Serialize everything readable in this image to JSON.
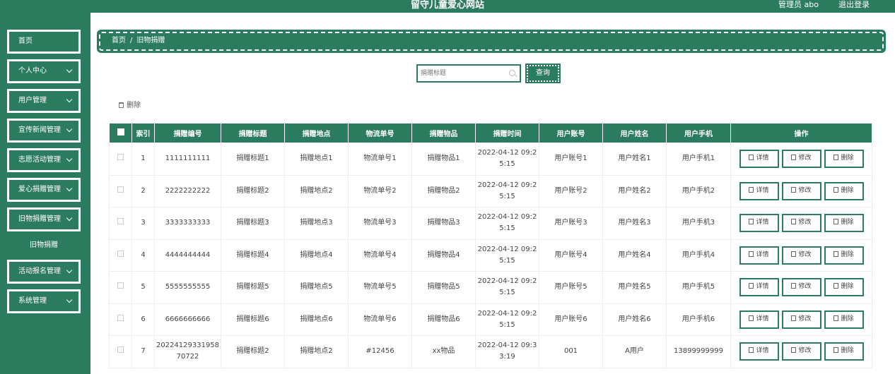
{
  "header": {
    "title": "留守儿童爱心网站",
    "user": "管理员 abo",
    "logout": "退出登录"
  },
  "sidebar": {
    "items": [
      {
        "label": "首页"
      },
      {
        "label": "个人中心"
      },
      {
        "label": "用户管理"
      },
      {
        "label": "宣传新闻管理"
      },
      {
        "label": "志愿活动管理"
      },
      {
        "label": "爱心捐赠管理"
      },
      {
        "label": "旧物捐赠管理"
      },
      {
        "label": "活动报名管理"
      },
      {
        "label": "系统管理"
      }
    ],
    "subitem": "旧物捐赠"
  },
  "breadcrumb": {
    "home": "首页",
    "sep": "/",
    "current": "旧物捐赠"
  },
  "search": {
    "placeholder": "捐赠标题",
    "button": "查询"
  },
  "toolbar": {
    "delete": "删除"
  },
  "table": {
    "headers": [
      "索引",
      "捐赠编号",
      "捐赠标题",
      "捐赠地点",
      "物流单号",
      "捐赠物品",
      "捐赠时间",
      "用户账号",
      "用户姓名",
      "用户手机",
      "操作"
    ],
    "rows": [
      [
        "1",
        "1111111111",
        "捐赠标题1",
        "捐赠地点1",
        "物流单号1",
        "捐赠物品1",
        "2022-04-12 09:25:15",
        "用户账号1",
        "用户姓名1",
        "用户手机1"
      ],
      [
        "2",
        "2222222222",
        "捐赠标题2",
        "捐赠地点2",
        "物流单号2",
        "捐赠物品2",
        "2022-04-12 09:25:15",
        "用户账号2",
        "用户姓名2",
        "用户手机2"
      ],
      [
        "3",
        "3333333333",
        "捐赠标题3",
        "捐赠地点3",
        "物流单号3",
        "捐赠物品3",
        "2022-04-12 09:25:15",
        "用户账号3",
        "用户姓名3",
        "用户手机3"
      ],
      [
        "4",
        "4444444444",
        "捐赠标题4",
        "捐赠地点4",
        "物流单号4",
        "捐赠物品4",
        "2022-04-12 09:25:15",
        "用户账号4",
        "用户姓名4",
        "用户手机4"
      ],
      [
        "5",
        "5555555555",
        "捐赠标题5",
        "捐赠地点5",
        "物流单号5",
        "捐赠物品5",
        "2022-04-12 09:25:15",
        "用户账号5",
        "用户姓名5",
        "用户手机5"
      ],
      [
        "6",
        "6666666666",
        "捐赠标题6",
        "捐赠地点6",
        "物流单号6",
        "捐赠物品6",
        "2022-04-12 09:25:15",
        "用户账号6",
        "用户姓名6",
        "用户手机6"
      ],
      [
        "7",
        "2022412933195870722",
        "捐赠标题2",
        "捐赠地点2",
        "#12456",
        "xx物品",
        "2022-04-12 09:33:19",
        "001",
        "A用户",
        "13899999999"
      ]
    ],
    "actions": {
      "detail": "详情",
      "edit": "修改",
      "delete": "删除"
    }
  },
  "colors": {
    "primary": "#2b7b5e"
  }
}
